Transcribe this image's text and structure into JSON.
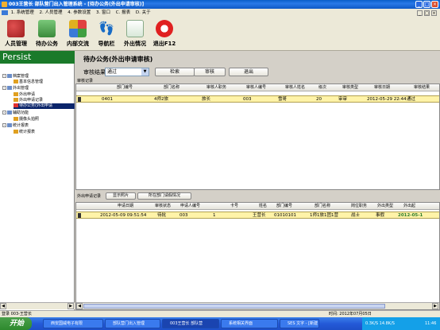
{
  "window": {
    "title": "003王营长   部队营门出入管理系统 - [待办公务(外出申请审核)]",
    "min": "_",
    "max": "□",
    "close": "×"
  },
  "menu": [
    "1. 系统管理",
    "2. 人员管理",
    "4. 参数设置",
    "3. 窗口",
    "C. 报表",
    "D. 关于"
  ],
  "toolbar": [
    {
      "label": "人员管理",
      "icon": "people-icon",
      "color": "#c03030"
    },
    {
      "label": "待办公务",
      "icon": "folder-icon",
      "color": "#3a9a3a"
    },
    {
      "label": "内部交流",
      "icon": "chat-icon",
      "color": "#3a7ad8"
    },
    {
      "label": "导航栏",
      "icon": "footprint-icon",
      "color": "#333333"
    },
    {
      "label": "外出情况",
      "icon": "document-icon",
      "color": "#5a9a5a"
    },
    {
      "label": "退出F12",
      "icon": "power-icon",
      "color": "#d82020"
    }
  ],
  "sidebar": {
    "header": "Persist",
    "tree": [
      {
        "label": "档案管理",
        "level": 0,
        "toggle": "-"
      },
      {
        "label": "基本信息管理",
        "level": 1
      },
      {
        "label": "外出管理",
        "level": 0,
        "toggle": "-"
      },
      {
        "label": "外出申请",
        "level": 1
      },
      {
        "label": "外出申请记录",
        "level": 1
      },
      {
        "label": "待办公务(外出申请",
        "level": 1,
        "selected": true
      },
      {
        "label": "辅助功能",
        "level": 0,
        "toggle": "-"
      },
      {
        "label": "摄像头拍照",
        "level": 1
      },
      {
        "label": "统计报表",
        "level": 0,
        "toggle": "-"
      },
      {
        "label": "统计报表",
        "level": 1
      }
    ]
  },
  "main": {
    "title": "待办公务(外出申请审核)",
    "filter_label": "审核结果",
    "filter_value": "通过",
    "buttons": {
      "search": "检索",
      "audit": "审核",
      "exit": "退出"
    },
    "grid1": {
      "caption": "审核记录",
      "columns": [
        "部门编号",
        "部门名称",
        "审核人职务",
        "审核人编号",
        "审核人姓名",
        "级次",
        "审核类型",
        "审核日期",
        "审核结果"
      ],
      "rows": [
        [
          "0401",
          "4师2旅",
          "旅长",
          "003",
          "雪哥",
          "20",
          "审审",
          "2012-05-29 22:44",
          "通过"
        ]
      ]
    },
    "grid2": {
      "caption": "外出申请记录",
      "btn_photo": "显示照片",
      "btn_dept": "所在部门请假情况",
      "columns": [
        "申请日期",
        "审核状态",
        "申请人编号",
        "卡号",
        "姓名",
        "部门编号",
        "部门名称",
        "岗位职务",
        "外出类型",
        "外出起"
      ],
      "rows": [
        [
          "2012-05-09 09:51:54",
          "待批",
          "003",
          "1",
          "王营长",
          "01010101",
          "1师1旅1团1营",
          "战士",
          "事假",
          "2012-05-1"
        ]
      ]
    }
  },
  "status": {
    "left": "登录 003-王营长",
    "right": "时间: 2012年07月05日"
  },
  "taskbar": {
    "start": "开始",
    "tasks": [
      "西安国威电子有限",
      "部队营门出入管理",
      "003王营长 部队营",
      "系统相关界面",
      "SES 文字 - [新建"
    ],
    "active_index": 2,
    "tray_text": "0.3K/S  14.8K/S",
    "clock": "11:46"
  }
}
